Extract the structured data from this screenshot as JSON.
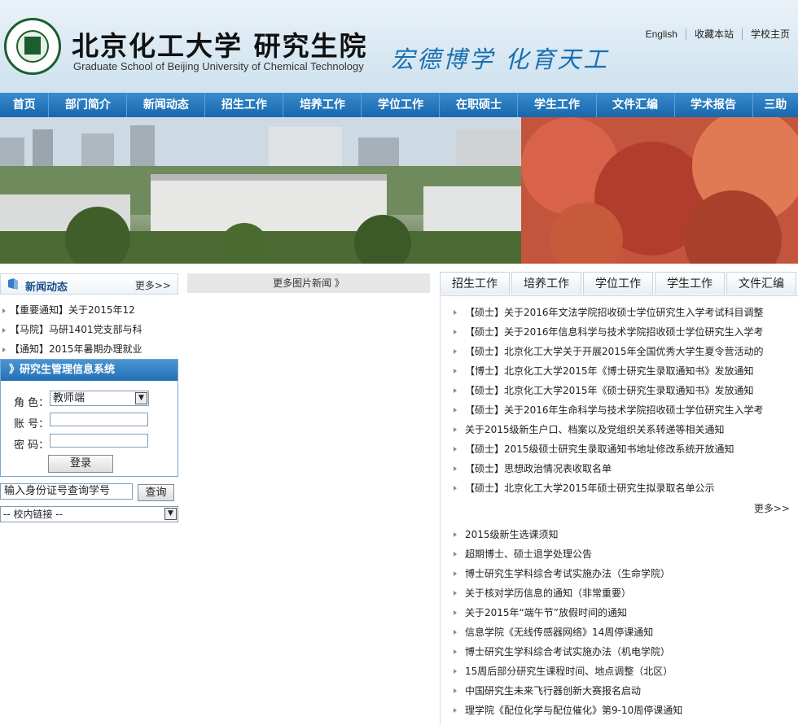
{
  "header": {
    "cn_name": "北京化工大学 研究生院",
    "en_name": "Graduate School of Beijing University of Chemical Technology",
    "motto": "宏德博学 化育天工",
    "top_links": [
      "English",
      "收藏本站",
      "学校主页"
    ]
  },
  "nav": [
    "首页",
    "部门简介",
    "新闻动态",
    "招生工作",
    "培养工作",
    "学位工作",
    "在职硕士",
    "学生工作",
    "文件汇编",
    "学术报告",
    "三助"
  ],
  "news": {
    "title": "新闻动态",
    "more": "更多>>",
    "items": [
      "【重要通知】关于2015年12",
      "【马院】马研1401党支部与科",
      "【通知】2015年暑期办理就业"
    ]
  },
  "login": {
    "title": "》研究生管理信息系统",
    "role_label": "角 色：",
    "role_value": "教师端",
    "account_label": "账 号：",
    "password_label": "密 码：",
    "submit": "登录"
  },
  "id_query": {
    "placeholder": "输入身份证号查询学号",
    "button": "查询"
  },
  "campus_links": "-- 校内链接 --",
  "pic_news": "更多图片新闻 》",
  "right_tabs": [
    "招生工作",
    "培养工作",
    "学位工作",
    "学生工作",
    "文件汇编"
  ],
  "right_items_1": [
    "【硕士】关于2016年文法学院招收硕士学位研究生入学考试科目调整",
    "【硕士】关于2016年信息科学与技术学院招收硕士学位研究生入学考",
    "【硕士】北京化工大学关于开展2015年全国优秀大学生夏令营活动的",
    "【博士】北京化工大学2015年《博士研究生录取通知书》发放通知",
    "【硕士】北京化工大学2015年《硕士研究生录取通知书》发放通知",
    "【硕士】关于2016年生命科学与技术学院招收硕士学位研究生入学考",
    "关于2015级新生户口、档案以及党组织关系转递等相关通知",
    "【硕士】2015级硕士研究生录取通知书地址修改系统开放通知",
    "【硕士】思想政治情况表收取名单",
    "【硕士】北京化工大学2015年硕士研究生拟录取名单公示"
  ],
  "right_more": "更多>>",
  "right_items_2": [
    "2015级新生选课须知",
    "超期博士、硕士退学处理公告",
    "博士研究生学科综合考试实施办法（生命学院）",
    "关于核对学历信息的通知（非常重要）",
    "关于2015年“端午节”放假时间的通知",
    "信息学院《无线传感器网络》14周停课通知",
    "博士研究生学科综合考试实施办法（机电学院）",
    "15周后部分研究生课程时间、地点调整（北区）",
    "中国研究生未来飞行器创新大赛报名启动",
    "理学院《配位化学与配位催化》第9-10周停课通知"
  ]
}
